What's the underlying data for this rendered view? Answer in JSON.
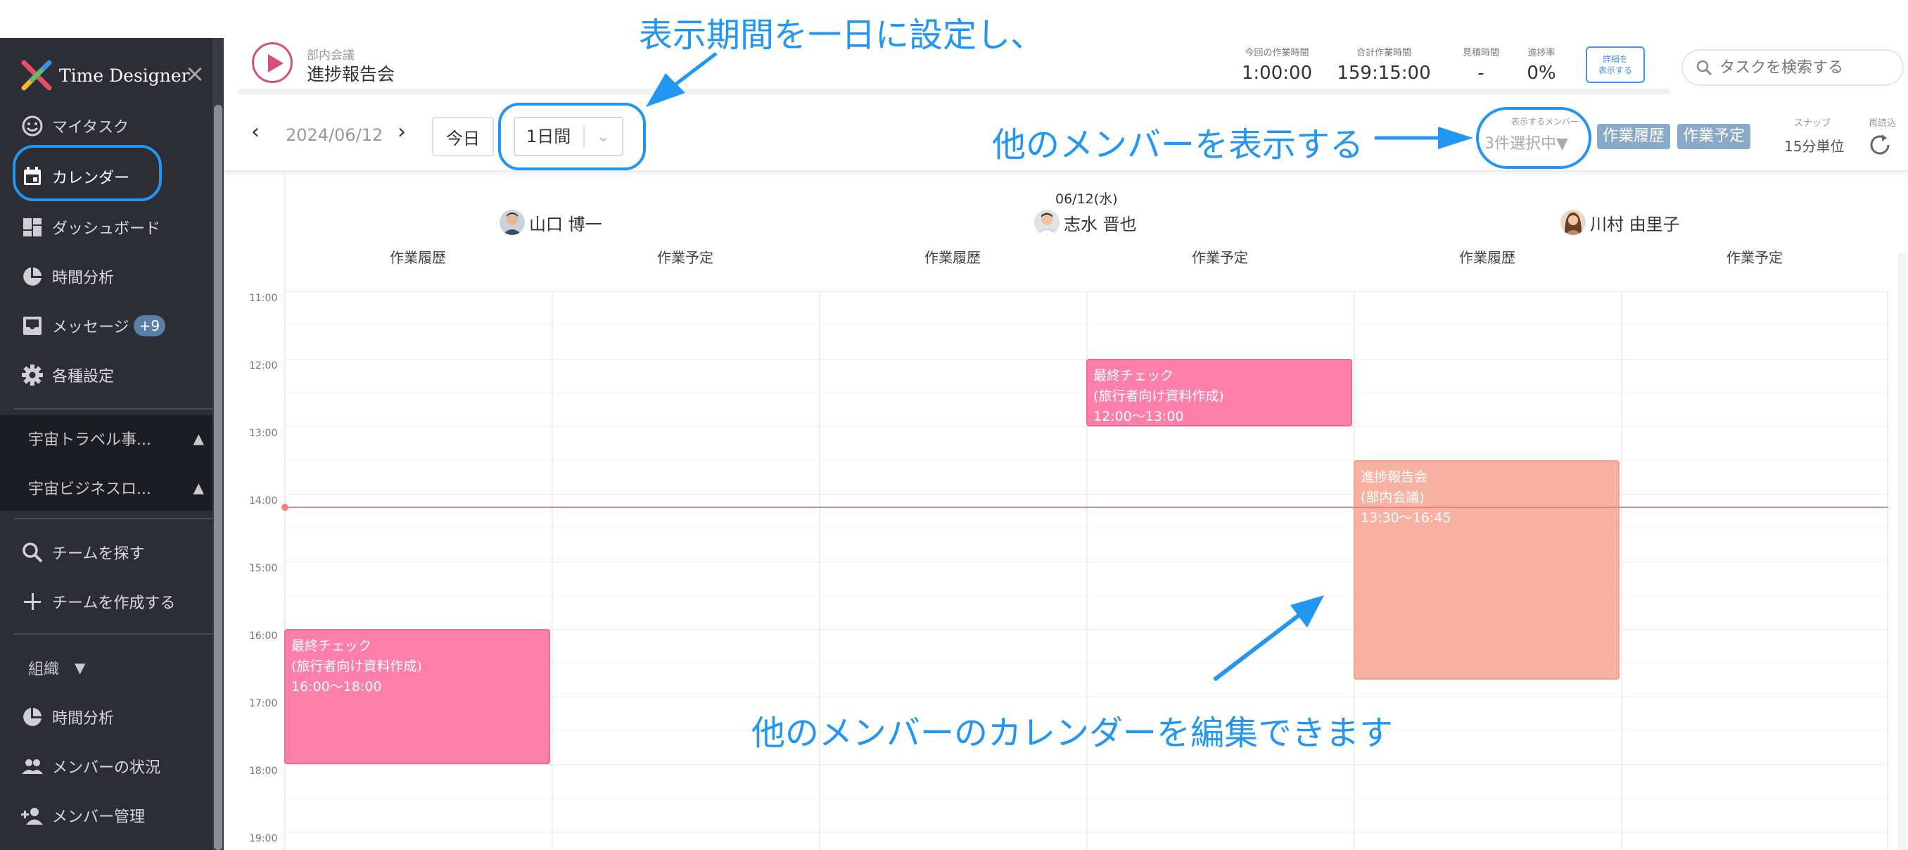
{
  "app": {
    "brand": "Time Designer",
    "close_glyph": "×"
  },
  "sidebar": {
    "items": [
      {
        "label": "マイタスク",
        "icon": "smiley-icon"
      },
      {
        "label": "カレンダー",
        "icon": "calendar-icon",
        "active": true
      },
      {
        "label": "ダッシュボード",
        "icon": "dashboard-icon"
      },
      {
        "label": "時間分析",
        "icon": "pie-chart-icon"
      },
      {
        "label": "メッセージ",
        "icon": "inbox-icon",
        "badge": "+9"
      },
      {
        "label": "各種設定",
        "icon": "gear-icon"
      }
    ],
    "projects": [
      {
        "label": "宇宙トラベル事...",
        "toggle": "▲"
      },
      {
        "label": "宇宙ビジネスロ...",
        "toggle": "▲"
      }
    ],
    "team_actions": [
      {
        "label": "チームを探す",
        "icon": "search-icon"
      },
      {
        "label": "チームを作成する",
        "icon": "plus-icon"
      }
    ],
    "org": {
      "label": "組織",
      "toggle": "▼"
    },
    "org_items": [
      {
        "label": "時間分析",
        "icon": "pie-chart-icon"
      },
      {
        "label": "メンバーの状況",
        "icon": "people-icon"
      },
      {
        "label": "メンバー管理",
        "icon": "person-add-icon"
      }
    ]
  },
  "header": {
    "task_category": "部内会議",
    "task_name": "進捗報告会",
    "stats": [
      {
        "label": "今回の作業時間",
        "value": "1:00:00"
      },
      {
        "label": "合計作業時間",
        "value": "159:15:00"
      },
      {
        "label": "見積時間",
        "value": "-"
      },
      {
        "label": "進捗率",
        "value": "0%"
      }
    ],
    "detail_button": [
      "詳細を",
      "表示する"
    ],
    "search_placeholder": "タスクを検索する"
  },
  "toolbar": {
    "prev": "‹",
    "next": "›",
    "date": "2024/06/12",
    "today": "今日",
    "period": "1日間",
    "period_arrow": "⌄",
    "members_label": "表示するメンバー",
    "members_value": "3件選択中▼",
    "toggle_history": "作業履歴",
    "toggle_plan": "作業予定",
    "snap_label": "スナップ",
    "snap_value": "15分単位",
    "reload_label": "再読込"
  },
  "calendar": {
    "date_label": "06/12(水)",
    "members": [
      {
        "name": "山口 博一"
      },
      {
        "name": "志水 晋也"
      },
      {
        "name": "川村 由里子"
      }
    ],
    "columns": [
      "作業履歴",
      "作業予定",
      "作業履歴",
      "作業予定",
      "作業履歴",
      "作業予定"
    ],
    "times": [
      "11:00",
      "12:00",
      "13:00",
      "14:00",
      "15:00",
      "16:00",
      "17:00",
      "18:00",
      "19:00"
    ],
    "events": [
      {
        "lines": [
          "最終チェック",
          "(旅行者向け資料作成)",
          "12:00〜13:00"
        ],
        "color": "#ff7fab"
      },
      {
        "lines": [
          "進捗報告会",
          "(部内会議)",
          "13:30〜16:45"
        ],
        "color": "#f9b2a2"
      },
      {
        "lines": [
          "最終チェック",
          "(旅行者向け資料作成)",
          "16:00〜18:00"
        ],
        "color": "#ff7fab"
      }
    ]
  },
  "annotations": {
    "period": "表示期間を一日に設定し、",
    "members": "他のメンバーを表示する",
    "edit": "他のメンバーのカレンダーを編集できます",
    "color": "#2196f3"
  }
}
